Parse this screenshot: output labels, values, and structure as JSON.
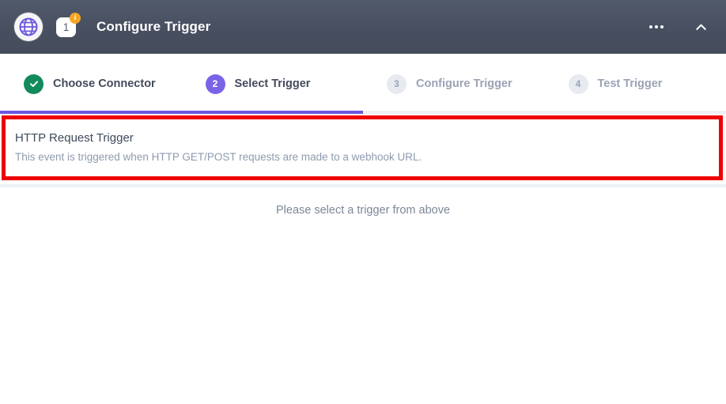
{
  "header": {
    "title": "Configure Trigger",
    "logo_icon": "globe-icon",
    "step_number_badge": "1",
    "info_badge_glyph": "i",
    "more_icon": "more-horizontal-icon",
    "collapse_icon": "chevron-up-icon",
    "background_color": "#474f60",
    "title_color": "#ffffff"
  },
  "stepper": {
    "progress_percent": 50,
    "progress_color": "#6a56de",
    "track_color": "#eef0f3",
    "steps": [
      {
        "number": "1",
        "label": "Choose Connector",
        "state": "done",
        "icon": "check-icon",
        "color": "#128a5c"
      },
      {
        "number": "2",
        "label": "Select Trigger",
        "state": "active",
        "color": "#7b63e8"
      },
      {
        "number": "3",
        "label": "Configure Trigger",
        "state": "idle",
        "color": "#e7eaf0"
      },
      {
        "number": "4",
        "label": "Test Trigger",
        "state": "idle",
        "color": "#e7eaf0"
      }
    ]
  },
  "trigger_list": {
    "highlight_border_color": "#ef0000",
    "items": [
      {
        "title": "HTTP Request Trigger",
        "description": "This event is triggered when HTTP GET/POST requests are made to a webhook URL."
      }
    ]
  },
  "main": {
    "empty_message": "Please select a trigger from above"
  }
}
